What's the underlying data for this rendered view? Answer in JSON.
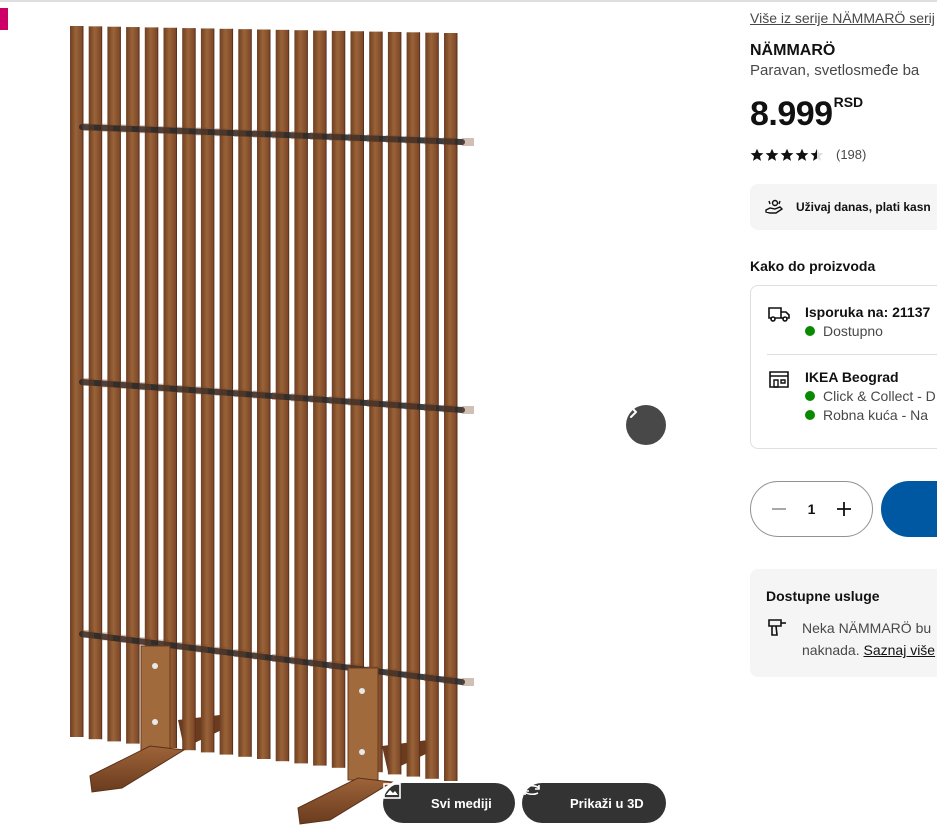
{
  "header": {
    "series_link": "Više iz serije NÄMMARÖ serij"
  },
  "product": {
    "name": "NÄMMARÖ",
    "description": "Paravan, svetlosmeđe ba",
    "price": "8.999",
    "currency": "RSD",
    "rating_value": 4.5,
    "review_count": "(198)"
  },
  "financing": {
    "text": "Uživaj danas, plati kasn",
    "icon": "payment-hand-icon"
  },
  "availability": {
    "title": "Kako do proizvoda",
    "delivery": {
      "icon": "truck-icon",
      "heading": "Isporuka na: 21137",
      "status": "Dostupno",
      "status_color": "#0a8a00"
    },
    "store": {
      "icon": "store-icon",
      "heading": "IKEA Beograd",
      "status_1": "Click & Collect - D",
      "status_2": "Robna kuća - Na"
    }
  },
  "purchase": {
    "quantity": "1",
    "add_button_color": "#0058a3"
  },
  "services": {
    "title": "Dostupne usluge",
    "line1": "Neka NÄMMARÖ bu",
    "line2_prefix": "naknada. ",
    "line2_link": "Saznaj više"
  },
  "gallery": {
    "media_button": "Svi mediji",
    "view3d_button": "Prikaži u 3D",
    "next_icon": "chevron-right-icon"
  },
  "colors": {
    "accent": "#0058a3",
    "badge": "#cc0066",
    "wood": "#8b5733"
  }
}
